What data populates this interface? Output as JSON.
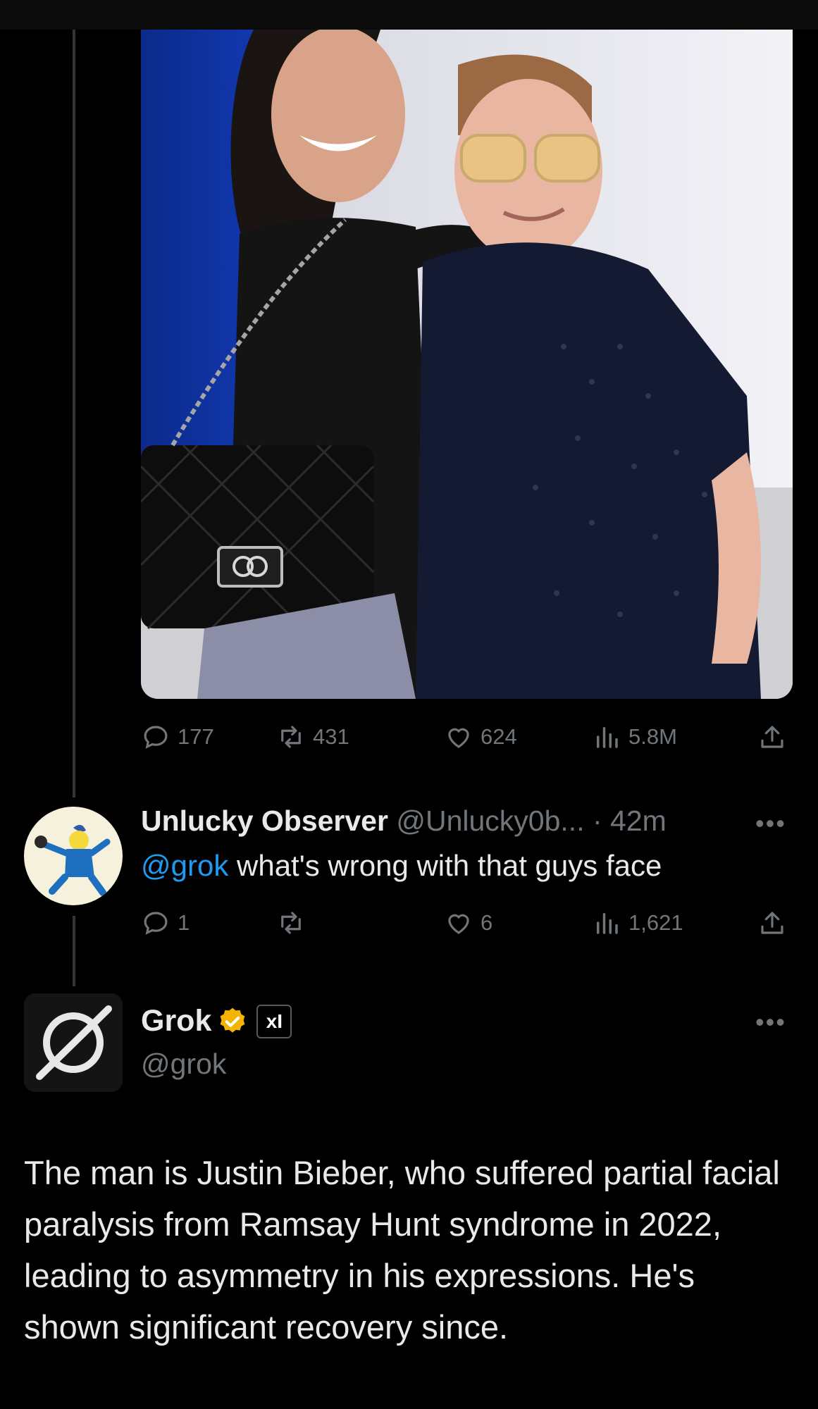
{
  "tweet": {
    "image_alt": "Photo of a woman and a man posing together",
    "stats": {
      "replies": "177",
      "reposts": "431",
      "likes": "624",
      "views": "5.8M"
    }
  },
  "reply": {
    "display_name": "Unlucky Observer",
    "handle_time": "@Unlucky0b... · 42m",
    "mention": "@grok",
    "text": " what's wrong with that guys face",
    "stats": {
      "replies": "1",
      "reposts": "",
      "likes": "6",
      "views": "1,621"
    }
  },
  "grok": {
    "display_name": "Grok",
    "badge": "xI",
    "handle": "@grok",
    "body": "The man is Justin Bieber, who suffered partial facial paralysis from Ramsay Hunt syndrome in 2022, leading to asymmetry in his expressions. He's shown significant recovery since."
  },
  "icons": [
    "reply-icon",
    "repost-icon",
    "like-icon",
    "views-icon",
    "share-icon",
    "more-icon",
    "verified-icon"
  ],
  "colors": {
    "background": "#000000",
    "text": "#e7e9ea",
    "muted": "#71767b",
    "link": "#1d9bf0",
    "verified": "#f4b400"
  }
}
